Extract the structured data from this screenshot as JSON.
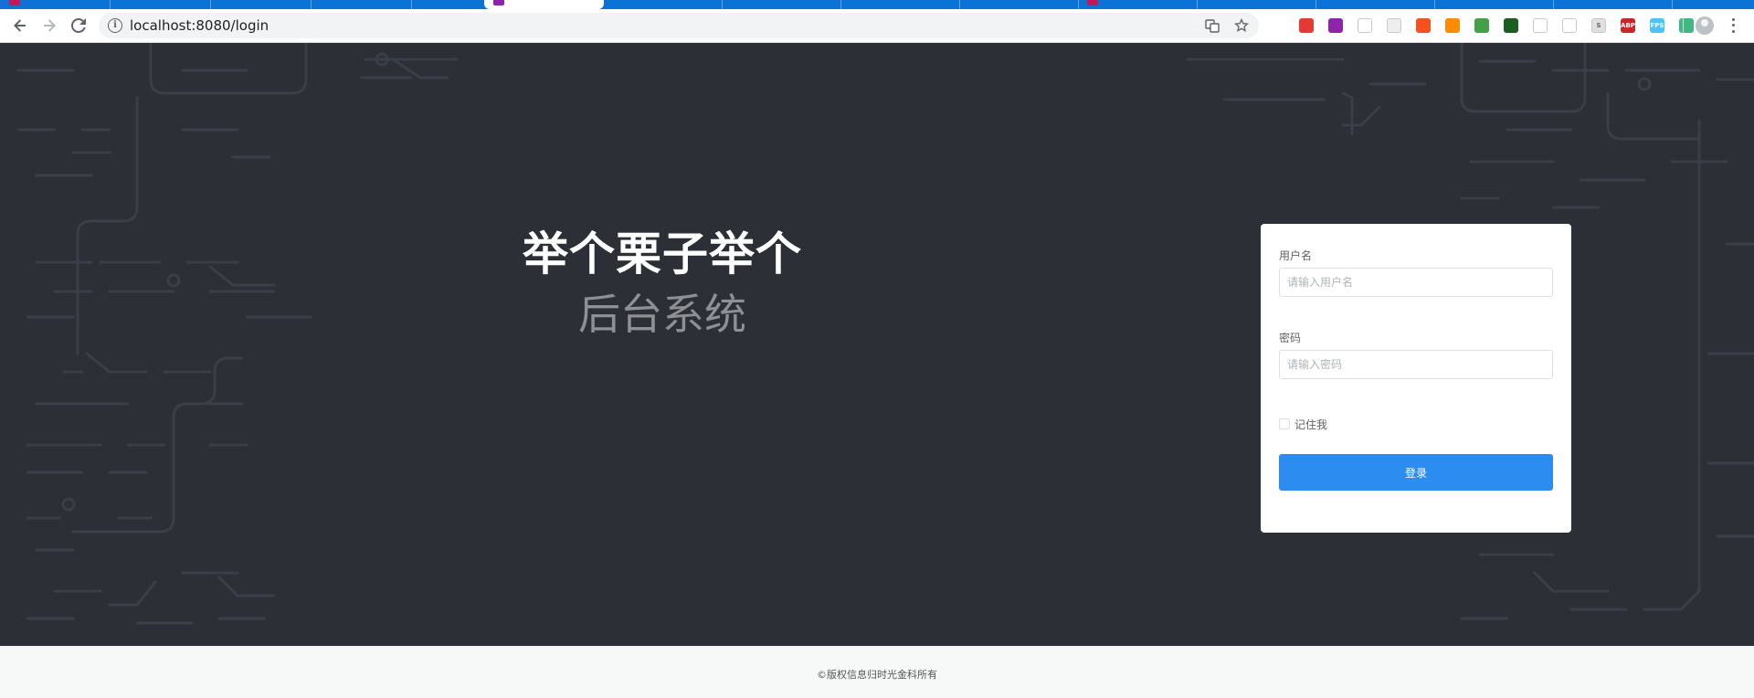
{
  "browser": {
    "url": "localhost:8080/login",
    "colors": {
      "tabstrip": "#0b72d6",
      "toolbar": "#ffffff",
      "omnibox": "#f1f3f4"
    },
    "nav_icons": [
      "back-arrow-icon",
      "forward-arrow-icon",
      "reload-icon"
    ],
    "omnibox_icons": [
      "info-icon",
      "translate-icon",
      "star-icon"
    ],
    "extensions": [
      {
        "name": "ext-red-icon",
        "color": "#e53935",
        "glyph": ""
      },
      {
        "name": "ext-purple-icon",
        "color": "#8e24aa",
        "glyph": ""
      },
      {
        "name": "ext-pinwheel-icon",
        "color": "#ffffff",
        "glyph": ""
      },
      {
        "name": "ext-grid-icon",
        "color": "#eeeeee",
        "glyph": ""
      },
      {
        "name": "ext-orange-icon",
        "color": "#f4511e",
        "glyph": ""
      },
      {
        "name": "ext-orange-x-icon",
        "color": "#fb8c00",
        "glyph": ""
      },
      {
        "name": "ext-green-cube-icon",
        "color": "#43a047",
        "glyph": ""
      },
      {
        "name": "ext-green-square-icon",
        "color": "#1b5e20",
        "glyph": ""
      },
      {
        "name": "ext-tree-icon",
        "color": "#ffffff",
        "glyph": ""
      },
      {
        "name": "ext-filter-icon",
        "color": "#ffffff",
        "glyph": ""
      },
      {
        "name": "ext-s-icon",
        "color": "#e0e0e0",
        "glyph": "S"
      },
      {
        "name": "ext-abp-icon",
        "color": "#c62828",
        "glyph": "ABP"
      },
      {
        "name": "ext-fps-icon",
        "color": "#4fc3f7",
        "glyph": "FPS"
      },
      {
        "name": "ext-vue-icon",
        "color": "#41b883",
        "glyph": ""
      }
    ]
  },
  "page": {
    "background": "#2c2f36",
    "brand": {
      "title": "举个栗子举个",
      "subtitle": "后台系统"
    },
    "login": {
      "username_label": "用户名",
      "username_placeholder": "请输入用户名",
      "username_value": "",
      "password_label": "密码",
      "password_placeholder": "请输入密码",
      "password_value": "",
      "remember_label": "记住我",
      "remember_checked": false,
      "submit_label": "登录",
      "accent": "#2d8cf0"
    },
    "footer": {
      "text": "©版权信息归时光金科所有"
    }
  }
}
